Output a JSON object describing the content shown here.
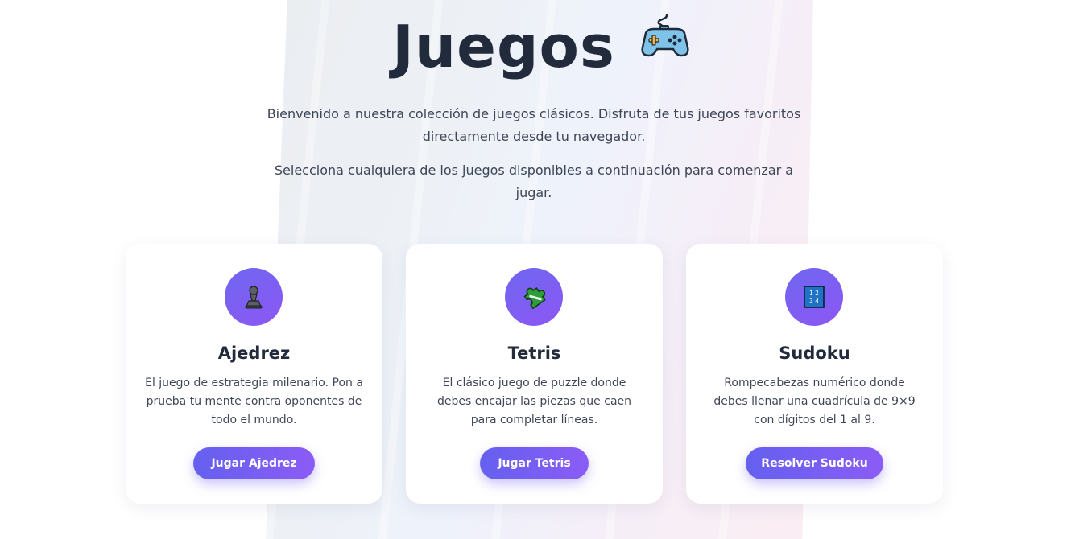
{
  "hero": {
    "title": "Juegos",
    "title_icon": "game-controller-icon",
    "intro_1": "Bienvenido a nuestra colección de juegos clásicos. Disfruta de tus juegos favoritos directamente desde tu navegador.",
    "intro_2": "Selecciona cualquiera de los juegos disponibles a continuación para comenzar a jugar."
  },
  "cards": [
    {
      "icon": "chess-pawn-icon",
      "title": "Ajedrez",
      "description": "El juego de estrategia milenario. Pon a prueba tu mente contra oponentes de todo el mundo.",
      "button_label": "Jugar Ajedrez"
    },
    {
      "icon": "puzzle-piece-icon",
      "title": "Tetris",
      "description": "El clásico juego de puzzle donde debes encajar las piezas que caen para completar líneas.",
      "button_label": "Jugar Tetris"
    },
    {
      "icon": "numbers-1234-icon",
      "title": "Sudoku",
      "description": "Rompecabezas numérico donde debes llenar una cuadrícula de 9×9 con dígitos del 1 al 9.",
      "button_label": "Resolver Sudoku"
    }
  ],
  "numbers_icon": {
    "row_1": "1 2",
    "row_2": "3 4"
  },
  "colors": {
    "accent_start": "#6560ef",
    "accent_end": "#8b5cf6",
    "title": "#222b3b"
  }
}
